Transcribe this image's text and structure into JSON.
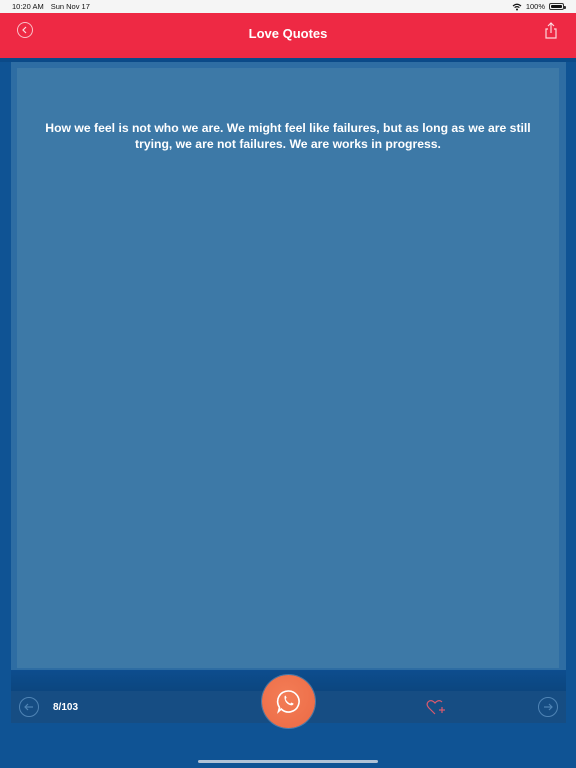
{
  "status_bar": {
    "time": "10:20 AM",
    "date": "Sun Nov 17",
    "battery": "100%",
    "battery_level": 1.0
  },
  "nav": {
    "title": "Love Quotes",
    "back_icon": "chevron-left-icon",
    "share_icon": "share-icon"
  },
  "quote": {
    "text": "How we feel is not who we are. We might feel like failures, but as long as we are still trying, we are not failures. We are works in progress."
  },
  "pager": {
    "counter": "8/103",
    "prev_icon": "arrow-left-icon",
    "next_icon": "arrow-right-icon",
    "favorite_icon": "heart-plus-icon",
    "whatsapp_icon": "whatsapp-icon"
  },
  "colors": {
    "nav_background": "#ee2944",
    "page_background": "#0f5394",
    "card_background": "#3d79a7",
    "whatsapp_button": "#ef7149"
  }
}
